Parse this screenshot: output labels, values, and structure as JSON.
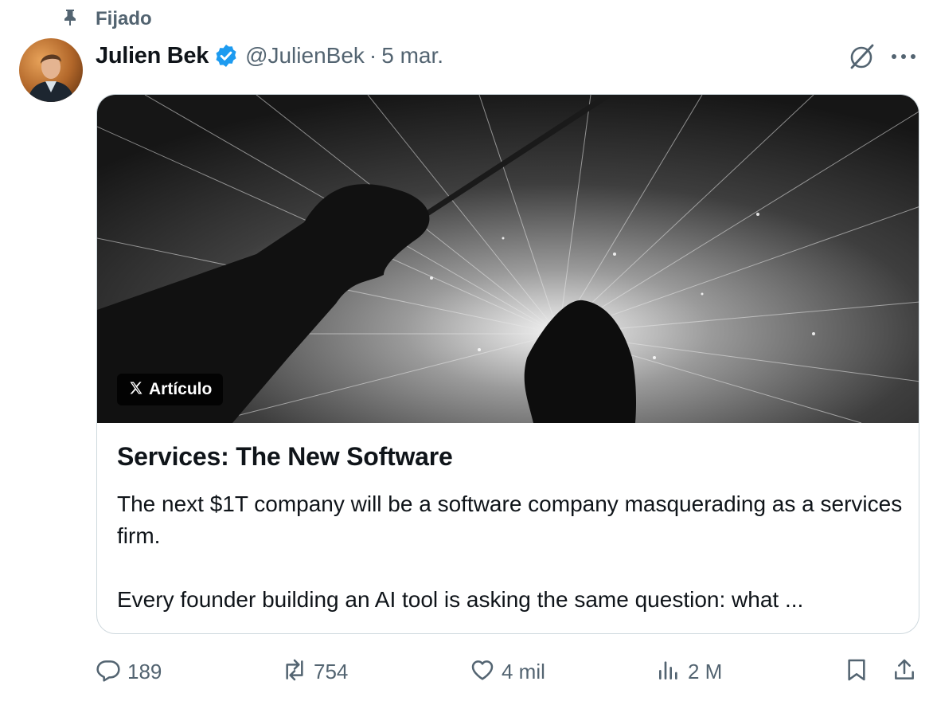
{
  "pinned": {
    "label": "Fijado",
    "icon": "pin-icon"
  },
  "author": {
    "display_name": "Julien Bek",
    "handle": "@JulienBek",
    "separator": "·",
    "time": "5 mar.",
    "verified_icon": "verified-badge-icon",
    "verified_color": "#1d9bf0"
  },
  "card": {
    "badge_label": "Artículo",
    "title": "Services: The New Software",
    "text_line1": "The next $1T company will be a software company masquerading as a services firm.",
    "text_line2": "Every founder building an AI tool is asking the same question: what ..."
  },
  "actions": {
    "replies": "189",
    "reposts": "754",
    "likes": "4 mil",
    "views": "2 M"
  },
  "colors": {
    "text_primary": "#0f1419",
    "text_secondary": "#536471",
    "border": "#cfd9de",
    "accent": "#1d9bf0"
  }
}
